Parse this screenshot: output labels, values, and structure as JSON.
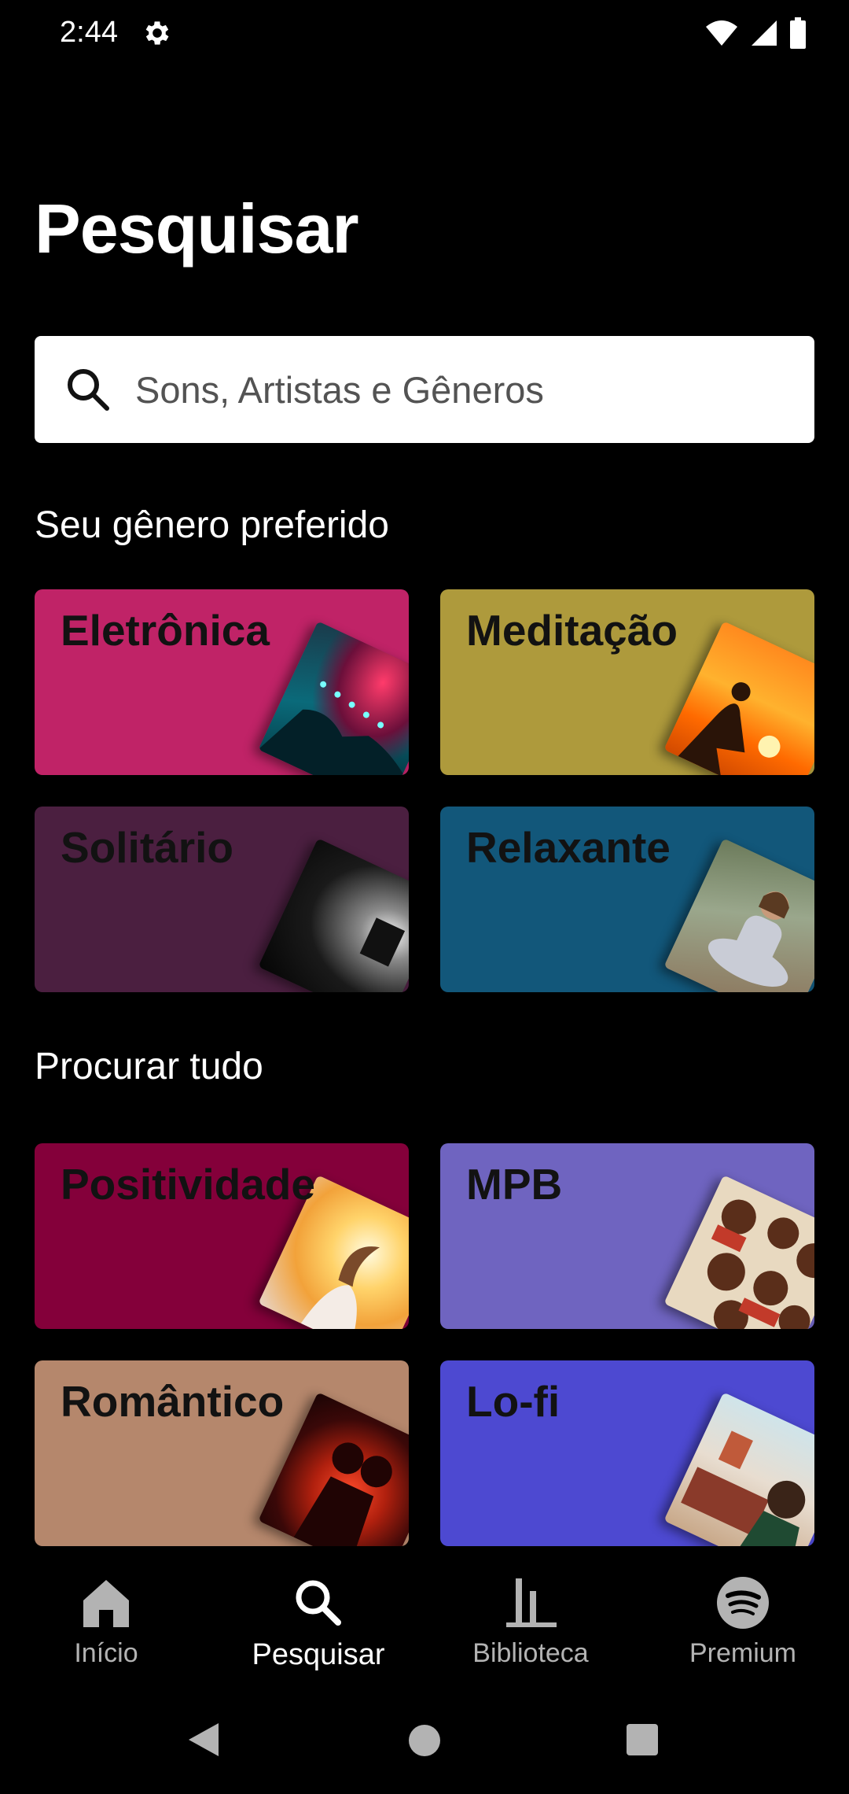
{
  "status_bar": {
    "time": "2:44"
  },
  "page": {
    "title": "Pesquisar"
  },
  "search": {
    "placeholder": "Sons, Artistas e Gêneros"
  },
  "sections": {
    "preferred": {
      "heading": "Seu gênero preferido",
      "cards": [
        {
          "label": "Eletrônica",
          "color": "#c02367"
        },
        {
          "label": "Meditação",
          "color": "#ae9a3c"
        },
        {
          "label": "Solitário",
          "color": "#4b1f40"
        },
        {
          "label": "Relaxante",
          "color": "#12577a"
        }
      ]
    },
    "browse": {
      "heading": "Procurar tudo",
      "cards": [
        {
          "label": "Positividade",
          "color": "#84003a"
        },
        {
          "label": "MPB",
          "color": "#6f64c0"
        },
        {
          "label": "Romântico",
          "color": "#b5876c"
        },
        {
          "label": "Lo-fi",
          "color": "#4d49d1"
        }
      ]
    }
  },
  "bottom_nav": {
    "items": [
      {
        "label": "Início",
        "icon": "home-icon",
        "active": false
      },
      {
        "label": "Pesquisar",
        "icon": "search-icon",
        "active": true
      },
      {
        "label": "Biblioteca",
        "icon": "library-icon",
        "active": false
      },
      {
        "label": "Premium",
        "icon": "spotify-icon",
        "active": false
      }
    ]
  },
  "system_nav": {
    "icons": [
      "back-icon",
      "home-circle-icon",
      "recents-icon"
    ]
  }
}
